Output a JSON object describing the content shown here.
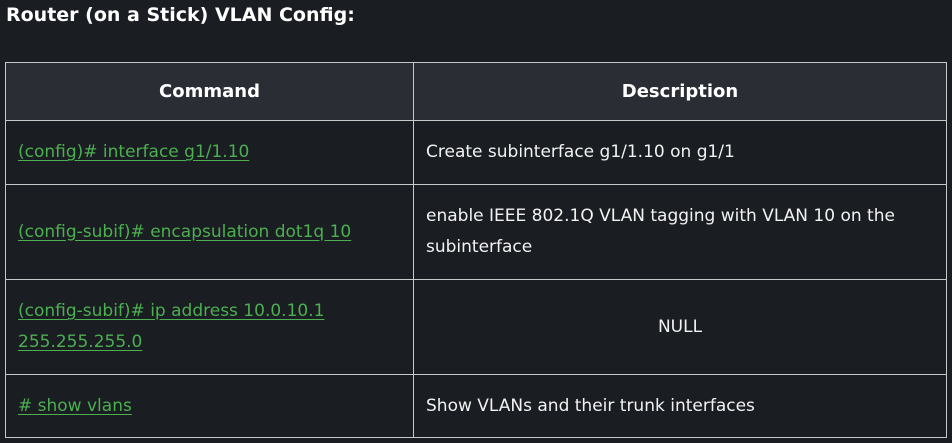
{
  "heading": "Router (on a Stick) VLAN Config:",
  "table": {
    "headers": [
      "Command",
      "Description"
    ],
    "rows": [
      {
        "command": "(config)# interface g1/1.10",
        "description": "Create subinterface g1/1.10 on g1/1"
      },
      {
        "command": "(config-subif)# encapsulation dot1q 10",
        "description": "enable IEEE 802.1Q VLAN tagging with VLAN 10 on the subinterface"
      },
      {
        "command": "(config-subif)# ip address 10.0.10.1 255.255.255.0",
        "description": "NULL"
      },
      {
        "command": "# show vlans",
        "description": "Show VLANs and their trunk interfaces"
      }
    ]
  },
  "colors": {
    "background": "#1a1d22",
    "header_background": "#2a2d33",
    "link": "#4caf50",
    "border": "#c8c8c8"
  }
}
